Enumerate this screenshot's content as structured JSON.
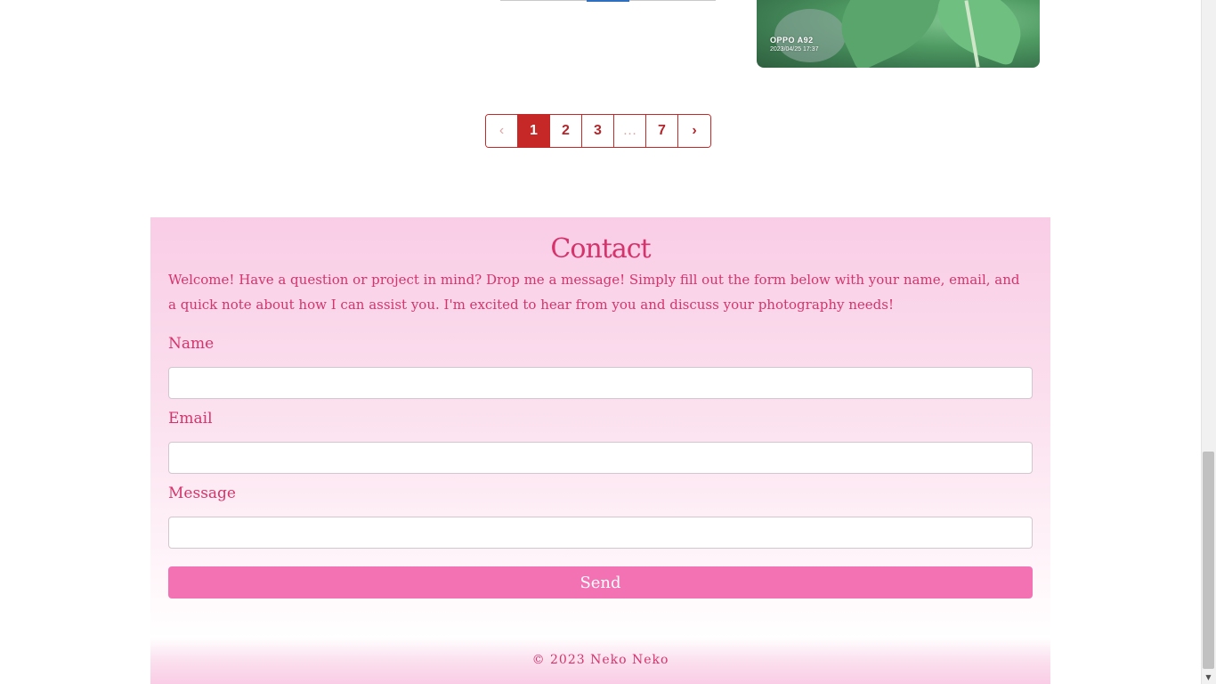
{
  "gallery": {
    "photo_watermark_device": "OPPO A92",
    "photo_watermark_timestamp": "2023/04/25 17:37"
  },
  "pagination": {
    "prev": "‹",
    "pages": [
      "1",
      "2",
      "3"
    ],
    "ellipsis": "…",
    "last": "7",
    "next": "›",
    "active_page": "1"
  },
  "contact": {
    "title": "Contact",
    "intro": "Welcome! Have a question or project in mind? Drop me a message! Simply fill out the form below with your name, email, and a quick note about how I can assist you. I'm excited to hear from you and discuss your photography needs!",
    "name_label": "Name",
    "email_label": "Email",
    "message_label": "Message",
    "name_value": "",
    "email_value": "",
    "message_value": "",
    "send_label": "Send"
  },
  "footer": {
    "copyright": "© 2023 Neko Neko"
  },
  "colors": {
    "accent": "#d6336c",
    "button": "#f272b4",
    "pagination_active": "#c62828",
    "section_bg_top": "#f9cde6"
  }
}
